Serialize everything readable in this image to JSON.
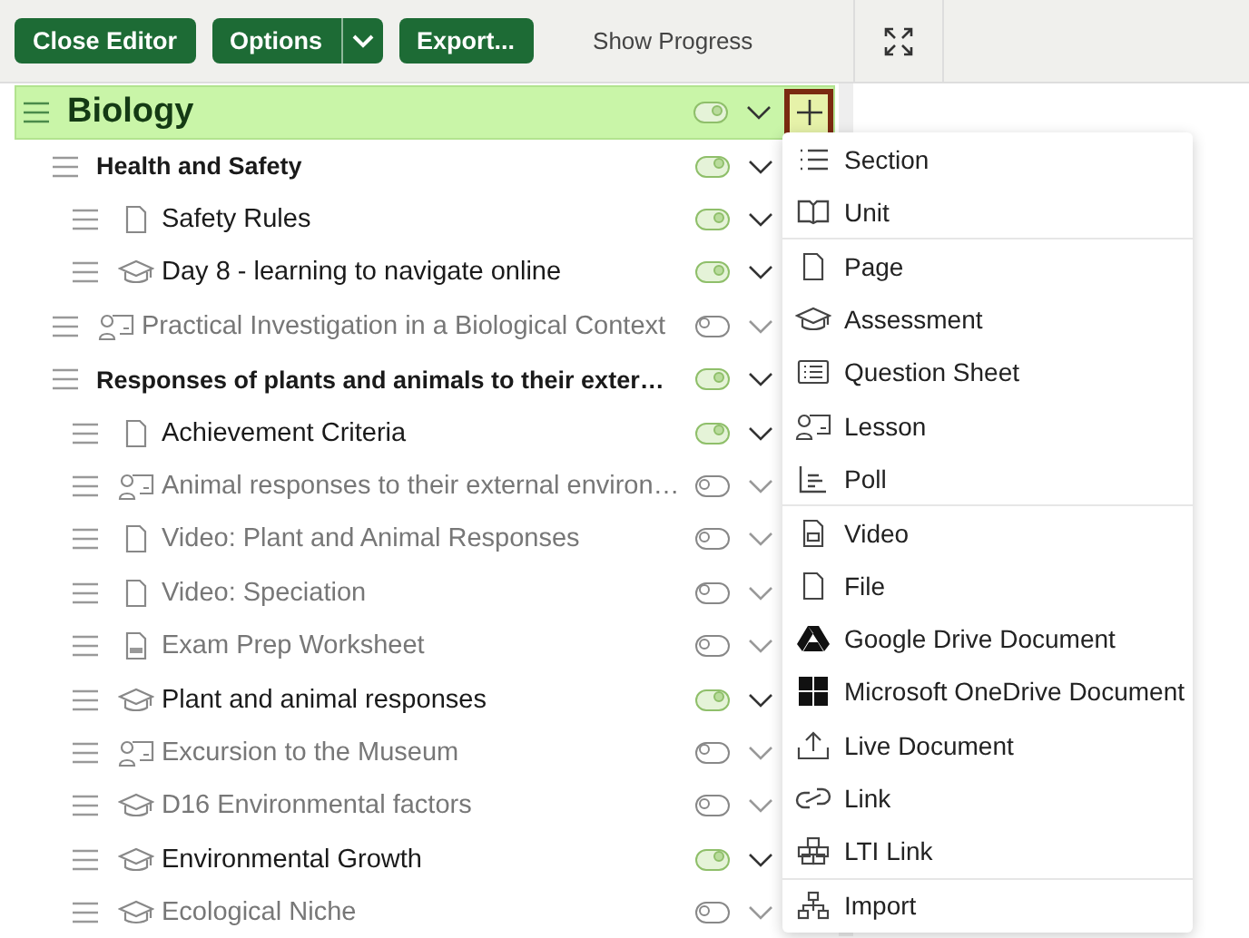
{
  "toolbar": {
    "buttons": [
      {
        "label": "Close Editor",
        "kind": "plain"
      },
      {
        "label": "Options",
        "kind": "split"
      },
      {
        "label": "Export...",
        "kind": "plain"
      }
    ],
    "show_progress": "Show Progress"
  },
  "tree": {
    "title": "Biology",
    "kind": "course",
    "published": true,
    "selected": true,
    "children": [
      {
        "title": "Health and Safety",
        "kind": "section",
        "published": true,
        "children": [
          {
            "title": "Safety Rules",
            "kind": "page",
            "published": true
          },
          {
            "title": "Day 8 - learning to navigate online",
            "kind": "assessment",
            "published": true
          }
        ]
      },
      {
        "title": "Practical Investigation in a Biological Context",
        "kind": "lesson",
        "published": false
      },
      {
        "title": "Responses of plants and animals to their exter…",
        "kind": "section",
        "published": true,
        "children": [
          {
            "title": "Achievement Criteria",
            "kind": "page",
            "published": true
          },
          {
            "title": "Animal responses to their external environ…",
            "kind": "lesson",
            "published": false
          },
          {
            "title": "Video: Plant and Animal Responses",
            "kind": "page",
            "published": false
          },
          {
            "title": "Video: Speciation",
            "kind": "page",
            "published": false
          },
          {
            "title": "Exam Prep Worksheet",
            "kind": "pdf",
            "published": false
          },
          {
            "title": "Plant and animal responses",
            "kind": "assessment",
            "published": true
          },
          {
            "title": "Excursion to the Museum",
            "kind": "lesson",
            "published": false
          },
          {
            "title": "D16 Environmental factors",
            "kind": "assessment",
            "published": false
          },
          {
            "title": "Environmental Growth",
            "kind": "assessment",
            "published": true
          },
          {
            "title": "Ecological Niche",
            "kind": "assessment",
            "published": false
          }
        ]
      }
    ]
  },
  "add_menu": {
    "groups": [
      [
        {
          "label": "Section",
          "kind": "section"
        },
        {
          "label": "Unit",
          "kind": "unit"
        }
      ],
      [
        {
          "label": "Page",
          "kind": "page"
        },
        {
          "label": "Assessment",
          "kind": "assessment"
        },
        {
          "label": "Question Sheet",
          "kind": "sheet"
        },
        {
          "label": "Lesson",
          "kind": "lesson"
        },
        {
          "label": "Poll",
          "kind": "poll"
        }
      ],
      [
        {
          "label": "Video",
          "kind": "video"
        },
        {
          "label": "File",
          "kind": "file"
        },
        {
          "label": "Google Drive Document",
          "kind": "drive"
        },
        {
          "label": "Microsoft OneDrive Document",
          "kind": "windows"
        },
        {
          "label": "Live Document",
          "kind": "upload"
        },
        {
          "label": "Link",
          "kind": "link"
        },
        {
          "label": "LTI Link",
          "kind": "blocks"
        }
      ],
      [
        {
          "label": "Import",
          "kind": "import"
        }
      ]
    ]
  }
}
